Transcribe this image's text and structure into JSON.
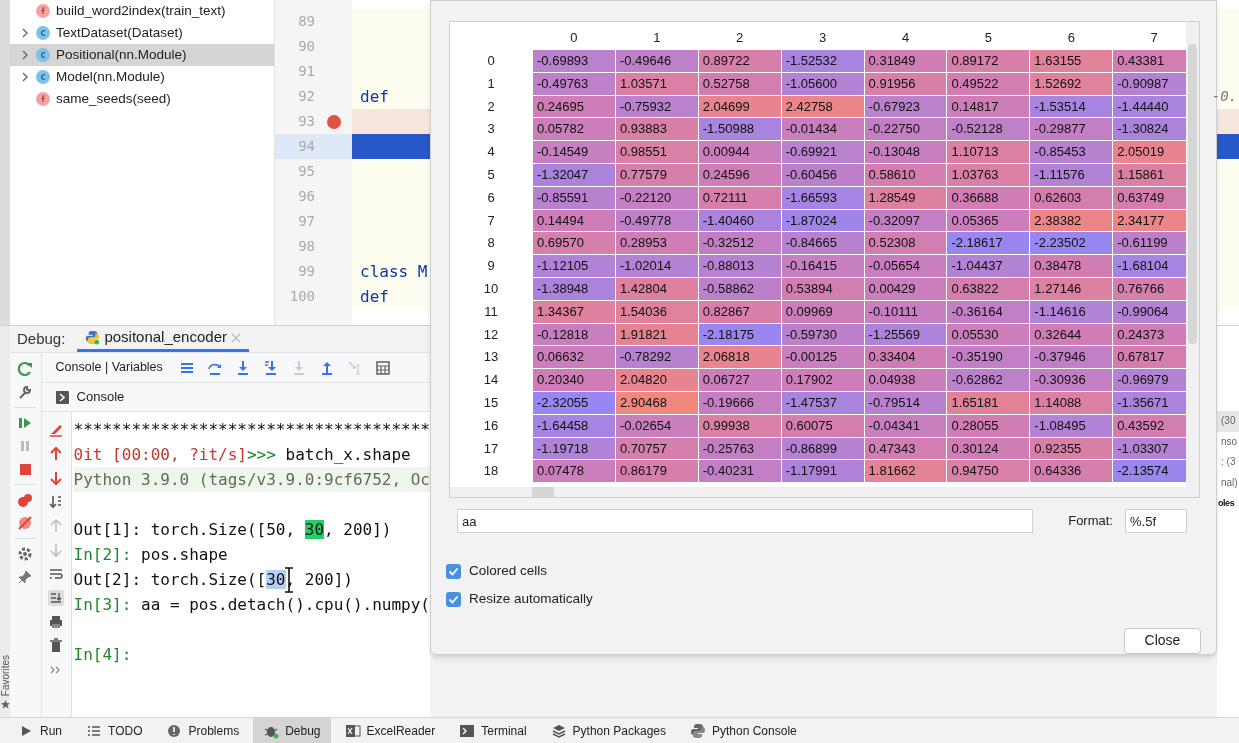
{
  "structure": {
    "items": [
      {
        "label": "build_word2index(train_text)",
        "kind": "function",
        "expandable": false,
        "selected": false
      },
      {
        "label": "TextDataset(Dataset)",
        "kind": "class",
        "expandable": true,
        "selected": false
      },
      {
        "label": "Positional(nn.Module)",
        "kind": "class",
        "expandable": true,
        "selected": true
      },
      {
        "label": "Model(nn.Module)",
        "kind": "class",
        "expandable": true,
        "selected": false
      },
      {
        "label": "same_seeds(seed)",
        "kind": "function",
        "expandable": false,
        "selected": false
      }
    ]
  },
  "editor": {
    "lines": [
      {
        "number": "89",
        "breakpoint": false,
        "current": false
      },
      {
        "number": "90",
        "breakpoint": false,
        "current": false
      },
      {
        "number": "91",
        "breakpoint": false,
        "current": false
      },
      {
        "number": "92",
        "breakpoint": false,
        "current": false,
        "code": "def",
        "tail": "-0."
      },
      {
        "number": "93",
        "breakpoint": true,
        "current": false
      },
      {
        "number": "94",
        "breakpoint": false,
        "current": true
      },
      {
        "number": "95",
        "breakpoint": false,
        "current": false
      },
      {
        "number": "96",
        "breakpoint": false,
        "current": false
      },
      {
        "number": "97",
        "breakpoint": false,
        "current": false
      },
      {
        "number": "98",
        "breakpoint": false,
        "current": false
      },
      {
        "number": "99",
        "breakpoint": false,
        "current": false,
        "code": "class M"
      },
      {
        "number": "100",
        "breakpoint": false,
        "current": false,
        "code": "def"
      }
    ]
  },
  "debug": {
    "title": "Debug:",
    "session_tab": "positonal_encoder",
    "view_tabs": "Console | Variables",
    "console_tab": "Console",
    "favorites": "Favorites",
    "console_lines": [
      {
        "kind": "plain",
        "segments": [
          {
            "text": "*************************************",
            "kind": "plain"
          }
        ]
      },
      {
        "kind": "plain",
        "segments": [
          {
            "text": "0it [00:00, ?it/s]",
            "kind": "red"
          },
          {
            "text": ">>>",
            "kind": "prompt"
          },
          {
            "text": " batch_x.shape",
            "kind": "plain"
          }
        ]
      },
      {
        "kind": "banner",
        "segments": [
          {
            "text": "Python 3.9.0 (tags/v3.9.0:9cf6752, Oc",
            "kind": "plain"
          }
        ]
      },
      {
        "kind": "plain",
        "blank_line_before": true,
        "segments": [
          {
            "text": "Out[1]: torch.Size([50, ",
            "kind": "plain"
          },
          {
            "text": "30",
            "kind": "match"
          },
          {
            "text": ", 200])",
            "kind": "plain"
          }
        ]
      },
      {
        "kind": "plain",
        "segments": [
          {
            "text": "In[2]:",
            "kind": "prompt"
          },
          {
            "text": " pos.shape",
            "kind": "plain"
          }
        ]
      },
      {
        "kind": "plain",
        "segments": [
          {
            "text": "Out[2]: torch.Size([",
            "kind": "plain"
          },
          {
            "text": "30",
            "kind": "selected"
          },
          {
            "text": ", 200])",
            "kind": "plain"
          }
        ]
      },
      {
        "kind": "plain",
        "segments": [
          {
            "text": "In[3]:",
            "kind": "prompt"
          },
          {
            "text": " aa = pos.detach().cpu().numpy(",
            "kind": "plain"
          }
        ]
      },
      {
        "kind": "plain",
        "blank_line_before": true,
        "segments": [
          {
            "text": "In[4]:",
            "kind": "prompt"
          }
        ]
      }
    ],
    "variables_fragments": [
      "(30",
      "nso",
      ": (3",
      "nal)",
      "oles"
    ]
  },
  "dialog": {
    "columns": [
      "0",
      "1",
      "2",
      "3",
      "4",
      "5",
      "6",
      "7"
    ],
    "rows": [
      {
        "index": "0",
        "cells": [
          "-0.69893",
          "-0.49646",
          "0.89722",
          "-1.52532",
          "0.31849",
          "0.89172",
          "1.63155",
          "0.43381"
        ]
      },
      {
        "index": "1",
        "cells": [
          "-0.49763",
          "1.03571",
          "0.52758",
          "-1.05600",
          "0.91956",
          "0.49522",
          "1.52692",
          "-0.90987"
        ]
      },
      {
        "index": "2",
        "cells": [
          "0.24695",
          "-0.75932",
          "2.04699",
          "2.42758",
          "-0.67923",
          "0.14817",
          "-1.53514",
          "-1.44440"
        ]
      },
      {
        "index": "3",
        "cells": [
          "0.05782",
          "0.93883",
          "-1.50988",
          "-0.01434",
          "-0.22750",
          "-0.52128",
          "-0.29877",
          "-1.30824"
        ]
      },
      {
        "index": "4",
        "cells": [
          "-0.14549",
          "0.98551",
          "0.00944",
          "-0.69921",
          "-0.13048",
          "1.10713",
          "-0.85453",
          "2.05019"
        ]
      },
      {
        "index": "5",
        "cells": [
          "-1.32047",
          "0.77579",
          "0.24596",
          "-0.60456",
          "0.58610",
          "1.03763",
          "-1.11576",
          "1.15861"
        ]
      },
      {
        "index": "6",
        "cells": [
          "-0.85591",
          "-0.22120",
          "0.72111",
          "-1.66593",
          "1.28549",
          "0.36688",
          "0.62603",
          "0.63749"
        ]
      },
      {
        "index": "7",
        "cells": [
          "0.14494",
          "-0.49778",
          "-1.40460",
          "-1.87024",
          "-0.32097",
          "0.05365",
          "2.38382",
          "2.34177"
        ]
      },
      {
        "index": "8",
        "cells": [
          "0.69570",
          "0.28953",
          "-0.32512",
          "-0.84665",
          "0.52308",
          "-2.18617",
          "-2.23502",
          "-0.61199"
        ]
      },
      {
        "index": "9",
        "cells": [
          "-1.12105",
          "-1.02014",
          "-0.88013",
          "-0.16415",
          "-0.05654",
          "-1.04437",
          "0.38478",
          "-1.68104"
        ]
      },
      {
        "index": "10",
        "cells": [
          "-1.38948",
          "1.42804",
          "-0.58862",
          "0.53894",
          "0.00429",
          "0.63822",
          "1.27146",
          "0.76766"
        ]
      },
      {
        "index": "11",
        "cells": [
          "1.34367",
          "1.54036",
          "0.82867",
          "0.09969",
          "-0.10111",
          "-0.36164",
          "-1.14616",
          "-0.99064"
        ]
      },
      {
        "index": "12",
        "cells": [
          "-0.12818",
          "1.91821",
          "-2.18175",
          "-0.59730",
          "-1.25569",
          "0.05530",
          "0.32644",
          "0.24373"
        ]
      },
      {
        "index": "13",
        "cells": [
          "0.06632",
          "-0.78292",
          "2.06818",
          "-0.00125",
          "0.33404",
          "-0.35190",
          "-0.37946",
          "0.67817"
        ]
      },
      {
        "index": "14",
        "cells": [
          "0.20340",
          "2.04820",
          "0.06727",
          "0.17902",
          "0.04938",
          "-0.62862",
          "-0.30936",
          "-0.96979"
        ]
      },
      {
        "index": "15",
        "cells": [
          "-2.32055",
          "2.90468",
          "-0.19666",
          "-1.47537",
          "-0.79514",
          "1.65181",
          "1.14088",
          "-1.35671"
        ]
      },
      {
        "index": "16",
        "cells": [
          "-1.64458",
          "-0.02654",
          "0.99938",
          "0.60075",
          "-0.04341",
          "0.28055",
          "-1.08495",
          "0.43592"
        ]
      },
      {
        "index": "17",
        "cells": [
          "-1.19718",
          "0.70757",
          "-0.25763",
          "-0.86899",
          "0.47343",
          "0.30124",
          "0.92355",
          "-1.03307"
        ]
      },
      {
        "index": "18",
        "cells": [
          "0.07478",
          "0.86179",
          "-0.40231",
          "-1.17991",
          "1.81662",
          "0.94750",
          "0.64336",
          "-2.13574"
        ]
      }
    ],
    "expression": "aa",
    "format_label": "Format:",
    "format": "%.5f",
    "options": [
      {
        "label": "Colored cells",
        "checked": true
      },
      {
        "label": "Resize automatically",
        "checked": true
      }
    ],
    "close": "Close"
  },
  "tool_windows": [
    {
      "label": "Run",
      "selected": false
    },
    {
      "label": "TODO",
      "selected": false
    },
    {
      "label": "Problems",
      "selected": false
    },
    {
      "label": "Debug",
      "selected": true
    },
    {
      "label": "ExcelReader",
      "selected": false
    },
    {
      "label": "Terminal",
      "selected": false
    },
    {
      "label": "Python Packages",
      "selected": false
    },
    {
      "label": "Python Console",
      "selected": false
    }
  ]
}
